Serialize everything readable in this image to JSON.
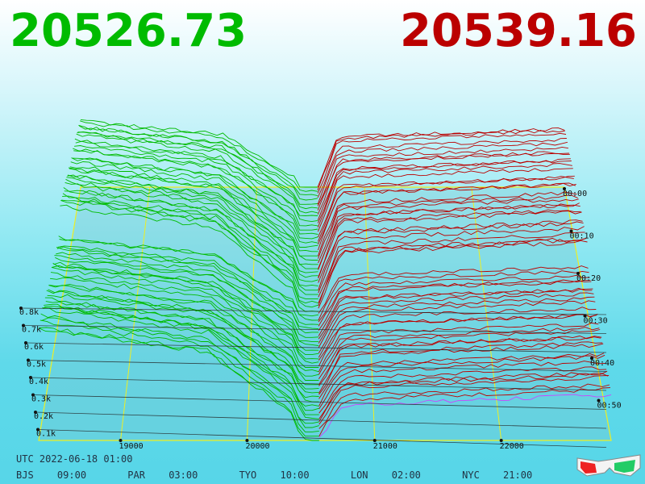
{
  "bid_price": "20526.73",
  "ask_price": "20539.16",
  "colors": {
    "bid": "#00bb00",
    "ask": "#bb0000",
    "grid": "#eeee22",
    "axis": "#222222",
    "floor": "#7cc8d2",
    "accent": "#cc44ff"
  },
  "time_axis": {
    "labels": [
      "00:00",
      "00:10",
      "00:20",
      "00:30",
      "00:40",
      "00:50"
    ]
  },
  "volume_axis": {
    "labels": [
      "0.8k",
      "0.7k",
      "0.6k",
      "0.5k",
      "0.4k",
      "0.3k",
      "0.2k",
      "0.1k"
    ]
  },
  "price_axis": {
    "labels": [
      "19000",
      "20000",
      "21000",
      "22000"
    ]
  },
  "utc_time": "UTC 2022-06-18 01:00",
  "cities": [
    {
      "code": "BJS",
      "time": "09:00"
    },
    {
      "code": "PAR",
      "time": "03:00"
    },
    {
      "code": "TYO",
      "time": "10:00"
    },
    {
      "code": "LON",
      "time": "02:00"
    },
    {
      "code": "NYC",
      "time": "21:00"
    }
  ],
  "icons": {
    "glasses": "3d-glasses-icon"
  }
}
